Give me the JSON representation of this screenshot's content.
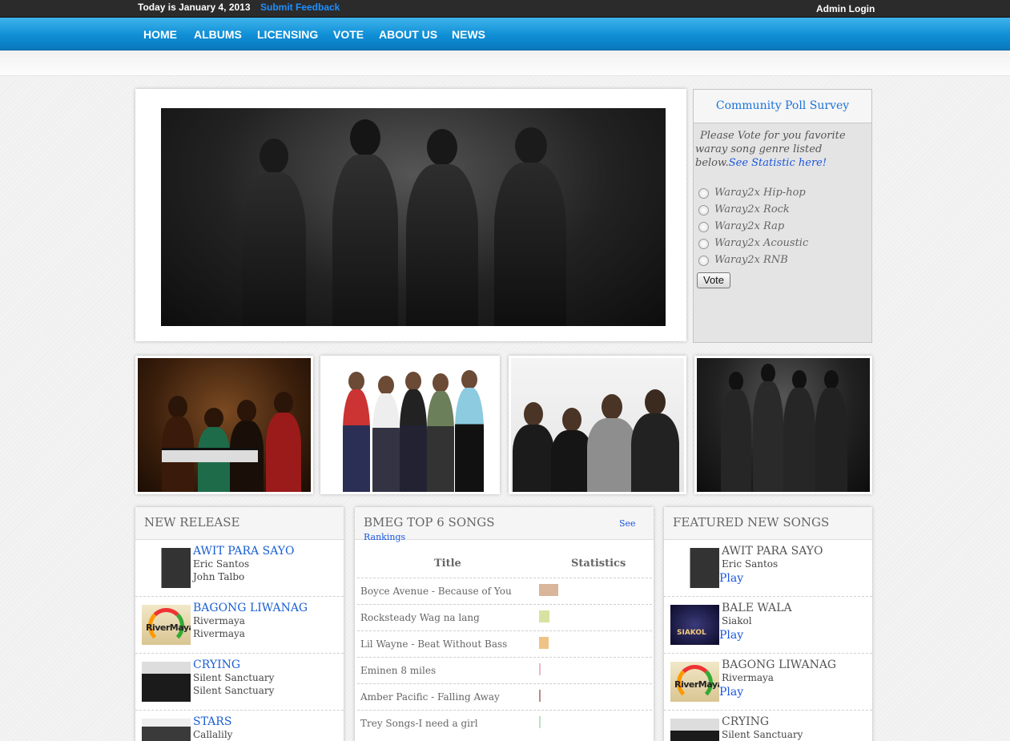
{
  "topbar": {
    "date_text": "Today is January 4, 2013",
    "feedback_link": "Submit Feedback",
    "admin_login": "Admin Login"
  },
  "nav": {
    "items": [
      "HOME",
      "ALBUMS",
      "LICENSING",
      "VOTE",
      "ABOUT US",
      "NEWS"
    ]
  },
  "poll": {
    "title": "Community Poll Survey",
    "description": "Please Vote for you favorite waray song genre listed below.",
    "statistic_link": "See Statistic here!",
    "options": [
      "Waray2x Hip-hop",
      "Waray2x Rock",
      "Waray2x Rap",
      "Waray2x Acoustic",
      "Waray2x RNB"
    ],
    "vote_button": "Vote"
  },
  "new_release": {
    "title": "NEW RELEASE",
    "items": [
      {
        "title": "AWIT PARA SAYO",
        "line1": "Eric Santos",
        "line2": "John Talbo"
      },
      {
        "title": "BAGONG LIWANAG",
        "line1": "Rivermaya",
        "line2": "Rivermaya"
      },
      {
        "title": "CRYING",
        "line1": "Silent Sanctuary",
        "line2": "Silent Sanctuary"
      },
      {
        "title": "STARS",
        "line1": "Callalily",
        "line2": ""
      }
    ]
  },
  "top_songs": {
    "title": "BMEG TOP 6 SONGS",
    "see_link": "See",
    "rankings_link": "Rankings",
    "col_title": "Title",
    "col_stats": "Statistics",
    "rows": [
      {
        "name": "Boyce Avenue - Because of You",
        "value": 24,
        "color": "#d9b59a"
      },
      {
        "name": "Rocksteady Wag na lang",
        "value": 13,
        "color": "#d8e3a2"
      },
      {
        "name": "Lil Wayne - Beat Without Bass",
        "value": 12,
        "color": "#efc387"
      },
      {
        "name": "Eminen 8 miles",
        "value": 2,
        "color": "#f0b5c4"
      },
      {
        "name": "Amber Pacific - Falling Away",
        "value": 2,
        "color": "#b58e87"
      },
      {
        "name": "Trey Songs-I need a girl",
        "value": 1,
        "color": "#b9e3c2"
      }
    ]
  },
  "featured": {
    "title": "FEATURED NEW SONGS",
    "play_label": "Play",
    "items": [
      {
        "title": "AWIT PARA SAYO",
        "artist": "Eric Santos"
      },
      {
        "title": "BALE WALA",
        "artist": "Siakol"
      },
      {
        "title": "BAGONG LIWANAG",
        "artist": "Rivermaya"
      },
      {
        "title": "CRYING",
        "artist": "Silent Sanctuary"
      }
    ]
  },
  "cover_text": {
    "rivermaya": "RiverMaya",
    "siakol": "SIAKOL"
  },
  "colors": {
    "nav_blue": "#0f8fd6",
    "link_blue": "#1a73d9",
    "topbar": "#2b2b2b"
  }
}
